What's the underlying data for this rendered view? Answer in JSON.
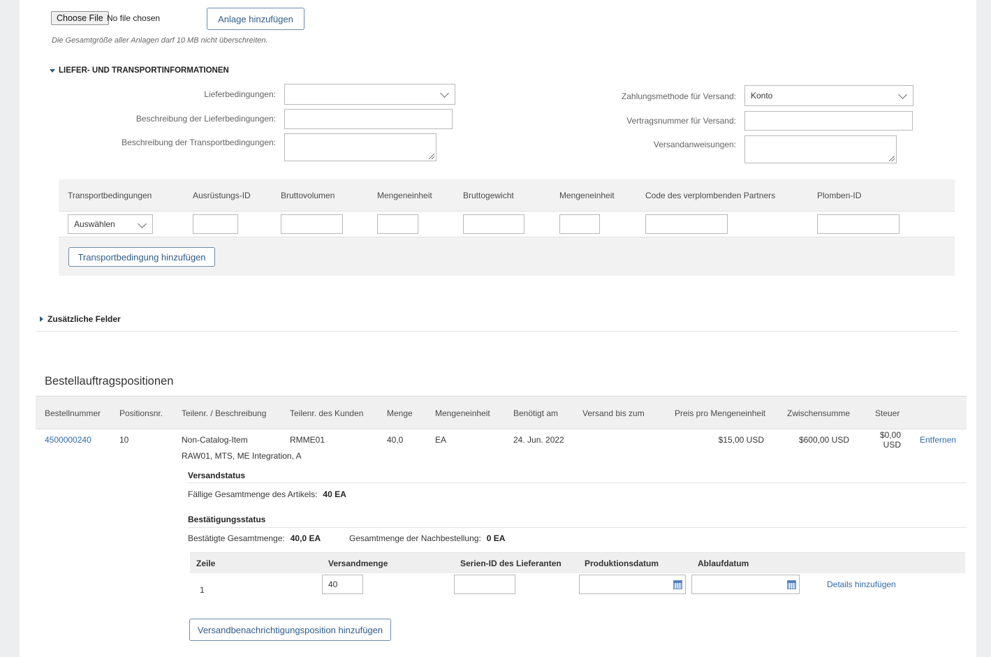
{
  "attachments": {
    "choose_file_label": "Choose File",
    "no_file_label": "No file chosen",
    "add_attachment_label": "Anlage hinzufügen",
    "size_note": "Die Gesamtgröße aller Anlagen darf 10 MB nicht überschreiten."
  },
  "delivery": {
    "section_title": "LIEFER- UND TRANSPORTINFORMATIONEN",
    "left_fields": [
      {
        "label": "Lieferbedingungen:",
        "type": "select",
        "value": ""
      },
      {
        "label": "Beschreibung der Lieferbedingungen:",
        "type": "text",
        "value": ""
      },
      {
        "label": "Beschreibung der Transportbedingungen:",
        "type": "textarea",
        "value": ""
      }
    ],
    "right_fields": [
      {
        "label": "Zahlungsmethode für Versand:",
        "type": "select",
        "value": "Konto"
      },
      {
        "label": "Vertragsnummer für Versand:",
        "type": "text",
        "value": ""
      },
      {
        "label": "Versandanweisungen:",
        "type": "textarea",
        "value": ""
      }
    ],
    "transport_table": {
      "headers": [
        "Transportbedingungen",
        "Ausrüstungs-ID",
        "Bruttovolumen",
        "Mengeneinheit",
        "Bruttogewicht",
        "Mengeneinheit",
        "Code des verplombenden Partners",
        "Plomben-ID"
      ],
      "select_value": "Auswählen",
      "add_button_label": "Transportbedingung hinzufügen"
    }
  },
  "additional_fields": {
    "title": "Zusätzliche Felder"
  },
  "line_items": {
    "title": "Bestellauftragspositionen",
    "headers": [
      "Bestellnummer",
      "Positionsnr.",
      "Teilenr. / Beschreibung",
      "Teilenr. des Kunden",
      "Menge",
      "Mengeneinheit",
      "Benötigt am",
      "Versand bis zum",
      "Preis pro Mengeneinheit",
      "Zwischensumme",
      "Steuer"
    ],
    "rows": [
      {
        "order_number": "4500000240",
        "position": "10",
        "part_number": "Non-Catalog-Item",
        "description": "RAW01, MTS, ME Integration, A",
        "customer_part": "RMME01",
        "quantity": "40,0",
        "unit": "EA",
        "need_by": "24. Jun. 2022",
        "ship_by": "",
        "unit_price": "$15,00 USD",
        "subtotal": "$600,00 USD",
        "tax_line1": "$0,00",
        "tax_line2": "USD",
        "remove_label": "Entfernen"
      }
    ],
    "shipping_status": {
      "title": "Versandstatus",
      "due_label": "Fällige Gesamtmenge des Artikels:",
      "due_value": "40 EA"
    },
    "confirmation_status": {
      "title": "Bestätigungsstatus",
      "confirmed_label": "Bestätigte Gesamtmenge:",
      "confirmed_value": "40,0 EA",
      "backorder_label": "Gesamtmenge der Nachbestellung:",
      "backorder_value": "0 EA"
    },
    "ship_table": {
      "headers": [
        "Zeile",
        "Versandmenge",
        "Serien-ID des Lieferanten",
        "Produktionsdatum",
        "Ablaufdatum"
      ],
      "rows": [
        {
          "line": "1",
          "ship_qty": "40",
          "serial_id": "",
          "production_date": "",
          "expiry_date": "",
          "details_label": "Details hinzufügen"
        }
      ]
    },
    "add_ship_notice_label": "Versandbenachrichtigungsposition hinzufügen"
  }
}
